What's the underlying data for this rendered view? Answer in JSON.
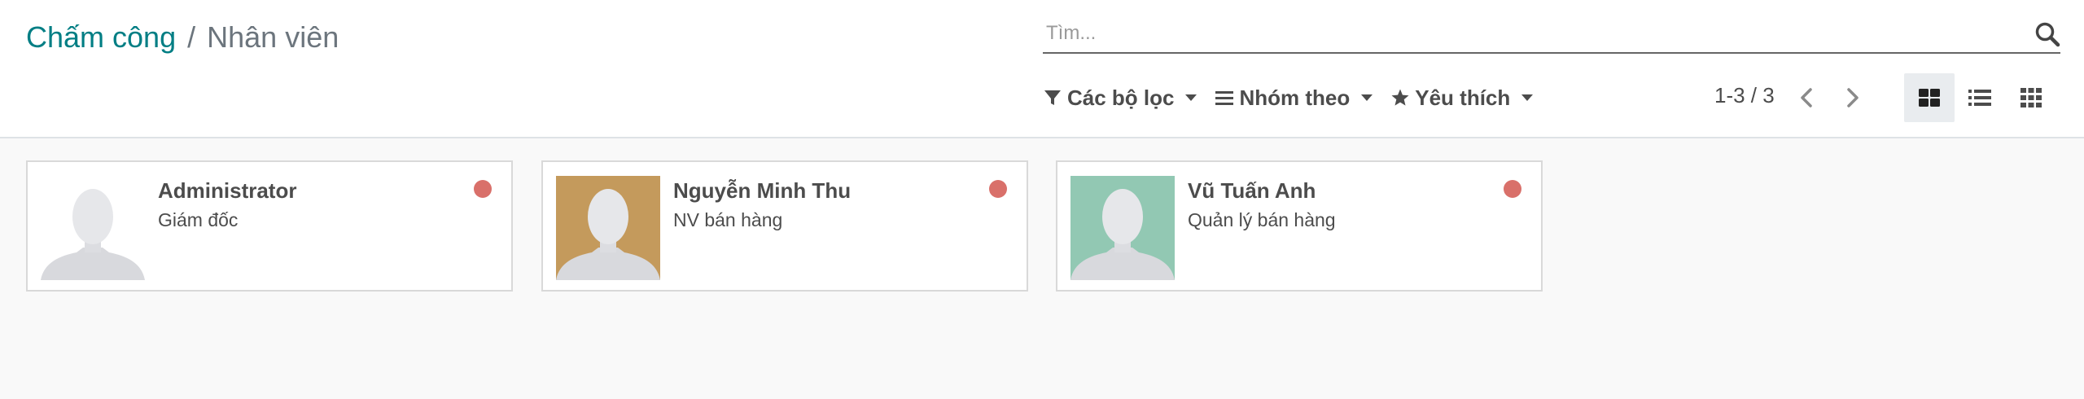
{
  "breadcrumb": {
    "parent": "Chấm công",
    "separator": "/",
    "current": "Nhân viên"
  },
  "search": {
    "placeholder": "Tìm...",
    "value": ""
  },
  "filters": [
    {
      "label": "Các bộ lọc",
      "icon": "filter-icon"
    },
    {
      "label": "Nhóm theo",
      "icon": "group-by-icon"
    },
    {
      "label": "Yêu thích",
      "icon": "star-icon"
    }
  ],
  "pager": {
    "value": "1-3 / 3"
  },
  "views": [
    {
      "name": "kanban",
      "icon": "kanban-view-icon",
      "active": true
    },
    {
      "name": "list",
      "icon": "list-view-icon",
      "active": false
    },
    {
      "name": "activity",
      "icon": "grid-view-icon",
      "active": false
    }
  ],
  "employees": [
    {
      "name": "Administrator",
      "job": "Giám đốc",
      "photo_bg": "#ffffff",
      "status": "absent",
      "status_color": "#d9706a"
    },
    {
      "name": "Nguyễn Minh Thu",
      "job": "NV bán hàng",
      "photo_bg": "#c49a5c",
      "status": "absent",
      "status_color": "#d9706a"
    },
    {
      "name": "Vũ Tuấn Anh",
      "job": "Quản lý bán hàng",
      "photo_bg": "#92c8b3",
      "status": "absent",
      "status_color": "#d9706a"
    }
  ],
  "colors": {
    "accent": "#017e84",
    "background": "#f9f9f9"
  }
}
